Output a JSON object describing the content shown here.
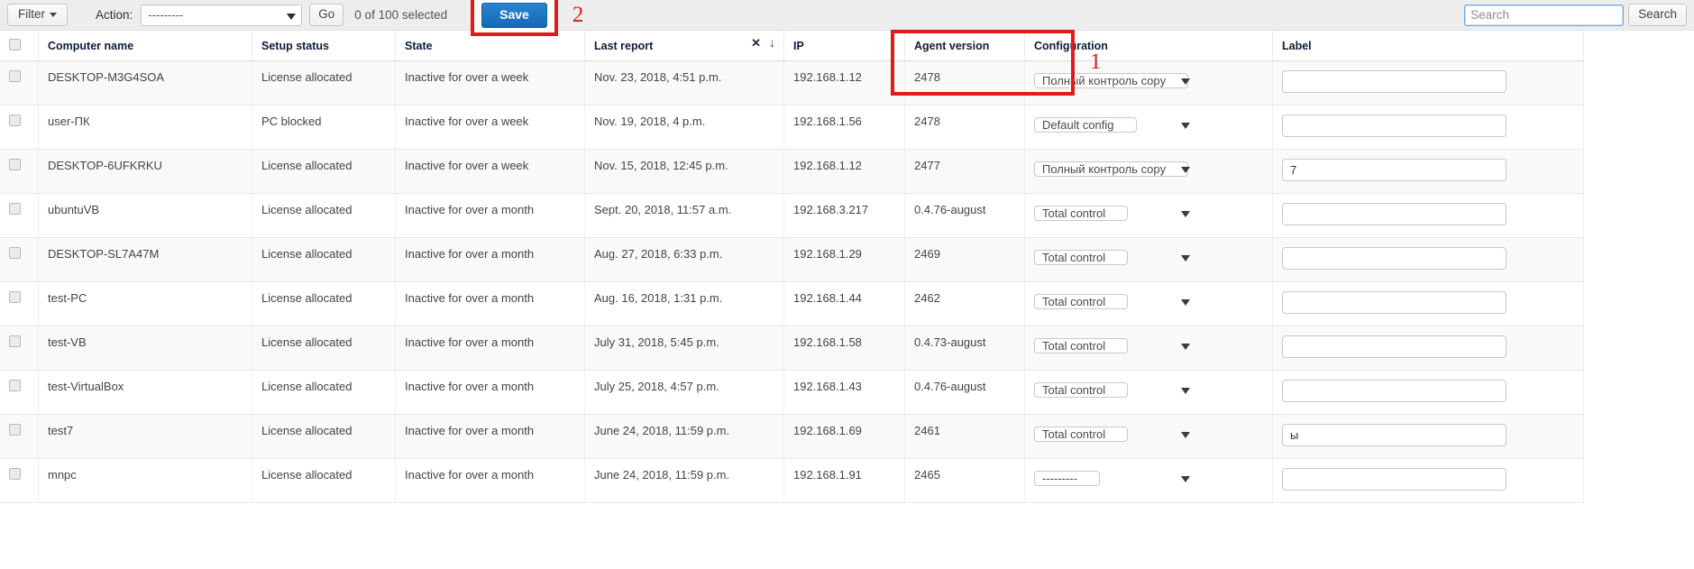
{
  "toolbar": {
    "filter_label": "Filter",
    "action_label": "Action:",
    "action_value": "---------",
    "go_label": "Go",
    "selection_count": "0 of 100 selected",
    "save_label": "Save",
    "annotation_2": "2",
    "search_placeholder": "Search",
    "search_value": "",
    "search_button_label": "Search"
  },
  "annotations": {
    "one": "1",
    "highlight_color": "#e01b1b"
  },
  "table": {
    "headers": {
      "computer_name": "Computer name",
      "setup_status": "Setup status",
      "state": "State",
      "last_report": "Last report",
      "ip": "IP",
      "agent_version": "Agent version",
      "configuration": "Configuration",
      "label": "Label"
    },
    "sort_icons": {
      "remove": "✕",
      "descending": "↓"
    },
    "rows": [
      {
        "computer_name": "DESKTOP-M3G4SOA",
        "setup_status": "License allocated",
        "state": "Inactive for over a week",
        "last_report": "Nov. 23, 2018, 4:51 p.m.",
        "ip": "192.168.1.12",
        "agent_version": "2478",
        "configuration": "Полный контроль copy",
        "label": ""
      },
      {
        "computer_name": "user-ПК",
        "setup_status": "PC blocked",
        "state": "Inactive for over a week",
        "last_report": "Nov. 19, 2018, 4 p.m.",
        "ip": "192.168.1.56",
        "agent_version": "2478",
        "configuration": "Default config",
        "label": ""
      },
      {
        "computer_name": "DESKTOP-6UFKRKU",
        "setup_status": "License allocated",
        "state": "Inactive for over a week",
        "last_report": "Nov. 15, 2018, 12:45 p.m.",
        "ip": "192.168.1.12",
        "agent_version": "2477",
        "configuration": "Полный контроль copy",
        "label": "7"
      },
      {
        "computer_name": "ubuntuVB",
        "setup_status": "License allocated",
        "state": "Inactive for over a month",
        "last_report": "Sept. 20, 2018, 11:57 a.m.",
        "ip": "192.168.3.217",
        "agent_version": "0.4.76-august",
        "configuration": "Total control",
        "label": ""
      },
      {
        "computer_name": "DESKTOP-SL7A47M",
        "setup_status": "License allocated",
        "state": "Inactive for over a month",
        "last_report": "Aug. 27, 2018, 6:33 p.m.",
        "ip": "192.168.1.29",
        "agent_version": "2469",
        "configuration": "Total control",
        "label": ""
      },
      {
        "computer_name": "test-PC",
        "setup_status": "License allocated",
        "state": "Inactive for over a month",
        "last_report": "Aug. 16, 2018, 1:31 p.m.",
        "ip": "192.168.1.44",
        "agent_version": "2462",
        "configuration": "Total control",
        "label": ""
      },
      {
        "computer_name": "test-VB",
        "setup_status": "License allocated",
        "state": "Inactive for over a month",
        "last_report": "July 31, 2018, 5:45 p.m.",
        "ip": "192.168.1.58",
        "agent_version": "0.4.73-august",
        "configuration": "Total control",
        "label": ""
      },
      {
        "computer_name": "test-VirtualBox",
        "setup_status": "License allocated",
        "state": "Inactive for over a month",
        "last_report": "July 25, 2018, 4:57 p.m.",
        "ip": "192.168.1.43",
        "agent_version": "0.4.76-august",
        "configuration": "Total control",
        "label": ""
      },
      {
        "computer_name": "test7",
        "setup_status": "License allocated",
        "state": "Inactive for over a month",
        "last_report": "June 24, 2018, 11:59 p.m.",
        "ip": "192.168.1.69",
        "agent_version": "2461",
        "configuration": "Total control",
        "label": "ы"
      },
      {
        "computer_name": "mnpc",
        "setup_status": "License allocated",
        "state": "Inactive for over a month",
        "last_report": "June 24, 2018, 11:59 p.m.",
        "ip": "192.168.1.91",
        "agent_version": "2465",
        "configuration": "---------",
        "label": ""
      }
    ]
  }
}
